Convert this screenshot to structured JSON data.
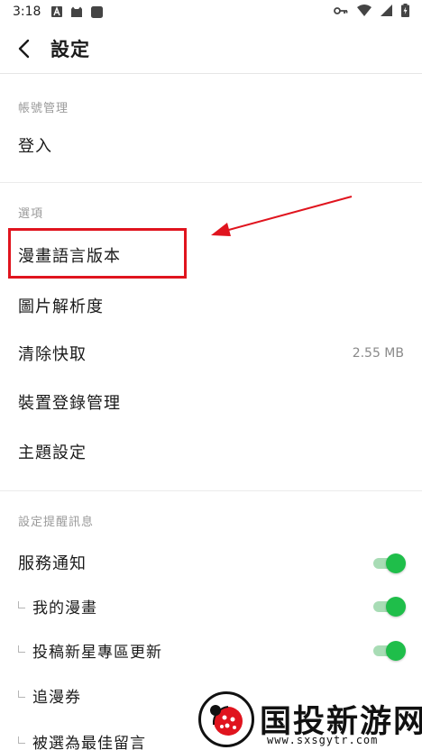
{
  "status_bar": {
    "time": "3:18"
  },
  "app_bar": {
    "title": "設定"
  },
  "account": {
    "header": "帳號管理",
    "login_label": "登入"
  },
  "options": {
    "header": "選項",
    "items": [
      {
        "label": "漫畫語言版本"
      },
      {
        "label": "圖片解析度"
      },
      {
        "label": "清除快取",
        "value": "2.55 MB"
      },
      {
        "label": "裝置登錄管理"
      },
      {
        "label": "主題設定"
      }
    ]
  },
  "notifications": {
    "header": "設定提醒訊息",
    "items": [
      {
        "label": "服務通知",
        "toggle": true
      },
      {
        "label": "我的漫畫",
        "toggle": true
      },
      {
        "label": "投稿新星專區更新",
        "toggle": true
      },
      {
        "label": "追漫券"
      },
      {
        "label": "被選為最佳留言"
      }
    ]
  },
  "watermark": {
    "title": "国投新游网",
    "url": "www.sxsgytr.com"
  },
  "colors": {
    "toggle_on": "#1fbe4a",
    "toggle_track": "#a8dcb5",
    "annotation": "#e0141e"
  }
}
